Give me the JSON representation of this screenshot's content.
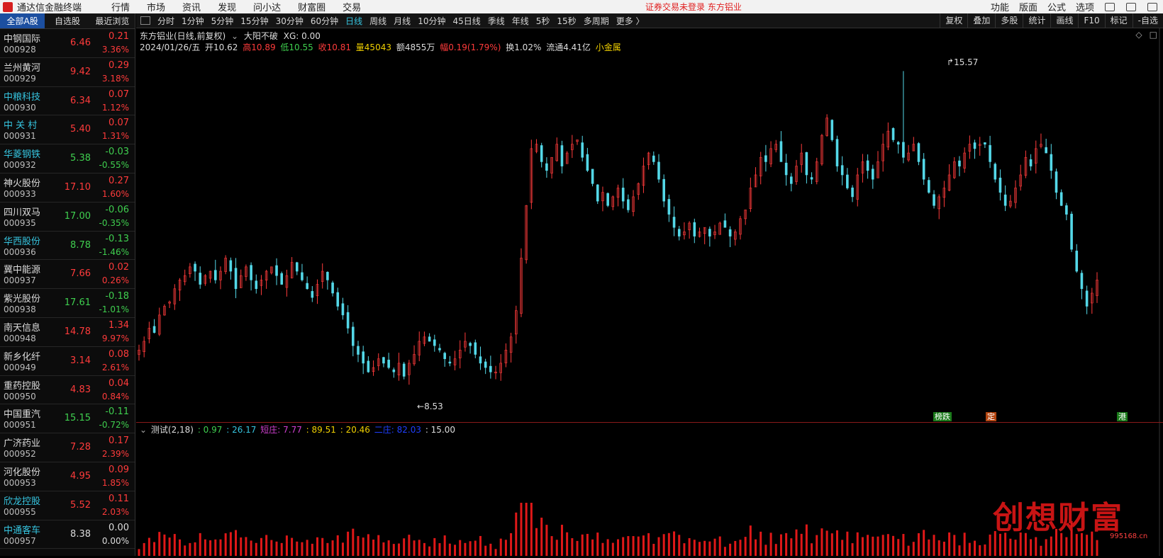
{
  "menubar": {
    "app_title": "通达信金融终端",
    "menus": [
      "行情",
      "市场",
      "资讯",
      "发现",
      "问小达",
      "财富圈",
      "交易"
    ],
    "notice": "证券交易未登录   东方铝业",
    "right_menus": [
      "功能",
      "版面",
      "公式",
      "选项"
    ]
  },
  "left_tabs": [
    "全部A股",
    "自选股",
    "最近浏览"
  ],
  "stocks": [
    {
      "name": "中钢国际",
      "code": "000928",
      "price": "6.46",
      "change": "0.21",
      "pct": "3.36%",
      "dir": "up",
      "ncolor": "#dcdcdc"
    },
    {
      "name": "兰州黄河",
      "code": "000929",
      "price": "9.42",
      "change": "0.29",
      "pct": "3.18%",
      "dir": "up",
      "ncolor": "#dcdcdc"
    },
    {
      "name": "中粮科技",
      "code": "000930",
      "price": "6.34",
      "change": "0.07",
      "pct": "1.12%",
      "dir": "up",
      "ncolor": "#36c5e0"
    },
    {
      "name": "中 关 村",
      "code": "000931",
      "price": "5.40",
      "change": "0.07",
      "pct": "1.31%",
      "dir": "up",
      "ncolor": "#36c5e0"
    },
    {
      "name": "华菱钢铁",
      "code": "000932",
      "price": "5.38",
      "change": "-0.03",
      "pct": "-0.55%",
      "dir": "down",
      "ncolor": "#36c5e0"
    },
    {
      "name": "神火股份",
      "code": "000933",
      "price": "17.10",
      "change": "0.27",
      "pct": "1.60%",
      "dir": "up",
      "ncolor": "#dcdcdc"
    },
    {
      "name": "四川双马",
      "code": "000935",
      "price": "17.00",
      "change": "-0.06",
      "pct": "-0.35%",
      "dir": "down",
      "ncolor": "#dcdcdc"
    },
    {
      "name": "华西股份",
      "code": "000936",
      "price": "8.78",
      "change": "-0.13",
      "pct": "-1.46%",
      "dir": "down",
      "ncolor": "#36c5e0"
    },
    {
      "name": "冀中能源",
      "code": "000937",
      "price": "7.66",
      "change": "0.02",
      "pct": "0.26%",
      "dir": "up",
      "ncolor": "#dcdcdc"
    },
    {
      "name": "紫光股份",
      "code": "000938",
      "price": "17.61",
      "change": "-0.18",
      "pct": "-1.01%",
      "dir": "down",
      "ncolor": "#dcdcdc"
    },
    {
      "name": "南天信息",
      "code": "000948",
      "price": "14.78",
      "change": "1.34",
      "pct": "9.97%",
      "dir": "up",
      "ncolor": "#dcdcdc"
    },
    {
      "name": "新乡化纤",
      "code": "000949",
      "price": "3.14",
      "change": "0.08",
      "pct": "2.61%",
      "dir": "up",
      "ncolor": "#dcdcdc"
    },
    {
      "name": "重药控股",
      "code": "000950",
      "price": "4.83",
      "change": "0.04",
      "pct": "0.84%",
      "dir": "up",
      "ncolor": "#dcdcdc"
    },
    {
      "name": "中国重汽",
      "code": "000951",
      "price": "15.15",
      "change": "-0.11",
      "pct": "-0.72%",
      "dir": "down",
      "ncolor": "#dcdcdc"
    },
    {
      "name": "广济药业",
      "code": "000952",
      "price": "7.28",
      "change": "0.17",
      "pct": "2.39%",
      "dir": "up",
      "ncolor": "#dcdcdc"
    },
    {
      "name": "河化股份",
      "code": "000953",
      "price": "4.95",
      "change": "0.09",
      "pct": "1.85%",
      "dir": "up",
      "ncolor": "#dcdcdc"
    },
    {
      "name": "欣龙控股",
      "code": "000955",
      "price": "5.52",
      "change": "0.11",
      "pct": "2.03%",
      "dir": "up",
      "ncolor": "#36c5e0"
    },
    {
      "name": "中通客车",
      "code": "000957",
      "price": "8.38",
      "change": "0.00",
      "pct": "0.00%",
      "dir": "flat",
      "ncolor": "#36c5e0"
    }
  ],
  "period_bar": {
    "periods": [
      "分时",
      "1分钟",
      "5分钟",
      "15分钟",
      "30分钟",
      "60分钟",
      "日线",
      "周线",
      "月线",
      "10分钟",
      "45日线",
      "季线",
      "年线",
      "5秒",
      "15秒",
      "多周期",
      "更多 〉"
    ],
    "selected": "日线",
    "tools": [
      "复权",
      "叠加",
      "多股",
      "统计",
      "画线",
      "F10",
      "标记",
      "-自选"
    ]
  },
  "chart_header": {
    "title": "东方铝业(日线,前复权)",
    "indicator": "大阳不破",
    "xg": "XG: 0.00",
    "date": "2024/01/26/五",
    "open": "开10.62",
    "high": "高10.89",
    "low": "低10.55",
    "close": "收10.81",
    "vol": "量45043",
    "amount": "额4855万",
    "amp": "幅0.19(1.79%)",
    "turnover": "换1.02%",
    "float": "流通4.41亿",
    "sector": "小金属"
  },
  "price_labels": {
    "max": "15.57",
    "min": "8.53"
  },
  "event_tags": [
    "榜跌",
    "定",
    "港"
  ],
  "indicator_header": {
    "name": "测试(2,18)",
    "v1": ": 0.97",
    "v2": ": 26.17",
    "l3": "短庄: 7.77",
    "l4": ": 89.51",
    "l5": ": 20.46",
    "l6": "二庄: 82.03",
    "l7": ": 15.00"
  },
  "watermark": {
    "text": "创想财富",
    "site": "995168.cn"
  },
  "colors": {
    "up": "#ff3b3b",
    "down": "#3fcf4f",
    "flat": "#dcdcdc",
    "accent": "#36c5e0"
  },
  "chart_data": {
    "type": "candlestick",
    "instrument": "东方铝业",
    "period": "日线",
    "high_label": 15.57,
    "low_label": 8.53,
    "close_path": [
      9.2,
      9.4,
      9.7,
      9.6,
      10.0,
      10.2,
      10.3,
      10.6,
      10.8,
      10.9,
      11.1,
      11.0,
      10.7,
      10.9,
      11.0,
      10.8,
      11.0,
      11.3,
      11.0,
      10.6,
      10.9,
      11.1,
      10.8,
      10.6,
      10.8,
      11.0,
      11.1,
      10.9,
      10.7,
      10.9,
      11.2,
      11.0,
      10.8,
      10.6,
      10.4,
      10.7,
      11.0,
      10.8,
      10.5,
      10.2,
      10.0,
      9.7,
      9.3,
      9.1,
      8.9,
      8.7,
      8.8,
      9.0,
      8.9,
      8.8,
      8.7,
      8.9,
      8.6,
      8.9,
      9.1,
      9.4,
      9.5,
      9.4,
      9.3,
      9.2,
      9.0,
      8.9,
      9.0,
      9.2,
      9.4,
      9.3,
      9.1,
      8.9,
      8.8,
      8.7,
      8.7,
      8.9,
      9.2,
      9.5,
      10.1,
      11.3,
      12.5,
      13.8,
      13.9,
      13.5,
      13.3,
      13.6,
      13.9,
      13.4,
      13.7,
      13.9,
      14.0,
      13.6,
      13.3,
      13.0,
      12.6,
      12.8,
      12.5,
      12.7,
      12.9,
      12.6,
      12.4,
      12.7,
      13.0,
      13.4,
      13.7,
      13.5,
      13.1,
      12.6,
      12.3,
      12.0,
      11.8,
      11.9,
      12.1,
      11.8,
      11.9,
      12.0,
      11.8,
      11.9,
      12.1,
      12.0,
      11.8,
      11.9,
      12.2,
      12.4,
      12.9,
      13.2,
      13.6,
      13.5,
      13.8,
      13.9,
      13.5,
      13.2,
      13.0,
      13.4,
      13.7,
      13.2,
      13.1,
      13.5,
      14.1,
      14.5,
      14.0,
      13.4,
      13.2,
      12.9,
      12.7,
      13.2,
      13.5,
      13.3,
      13.1,
      13.5,
      13.9,
      14.2,
      14.0,
      13.9,
      13.6,
      13.7,
      13.9,
      13.5,
      13.1,
      12.8,
      12.5,
      12.7,
      12.9,
      13.2,
      13.5,
      13.4,
      13.7,
      13.9,
      13.8,
      13.9,
      13.9,
      13.5,
      13.1,
      12.8,
      12.5,
      12.6,
      12.9,
      13.2,
      13.6,
      13.4,
      13.8,
      13.9,
      13.7,
      13.3,
      12.8,
      12.5,
      12.3,
      11.5,
      11.0,
      10.6,
      10.2,
      10.5,
      10.8
    ]
  }
}
